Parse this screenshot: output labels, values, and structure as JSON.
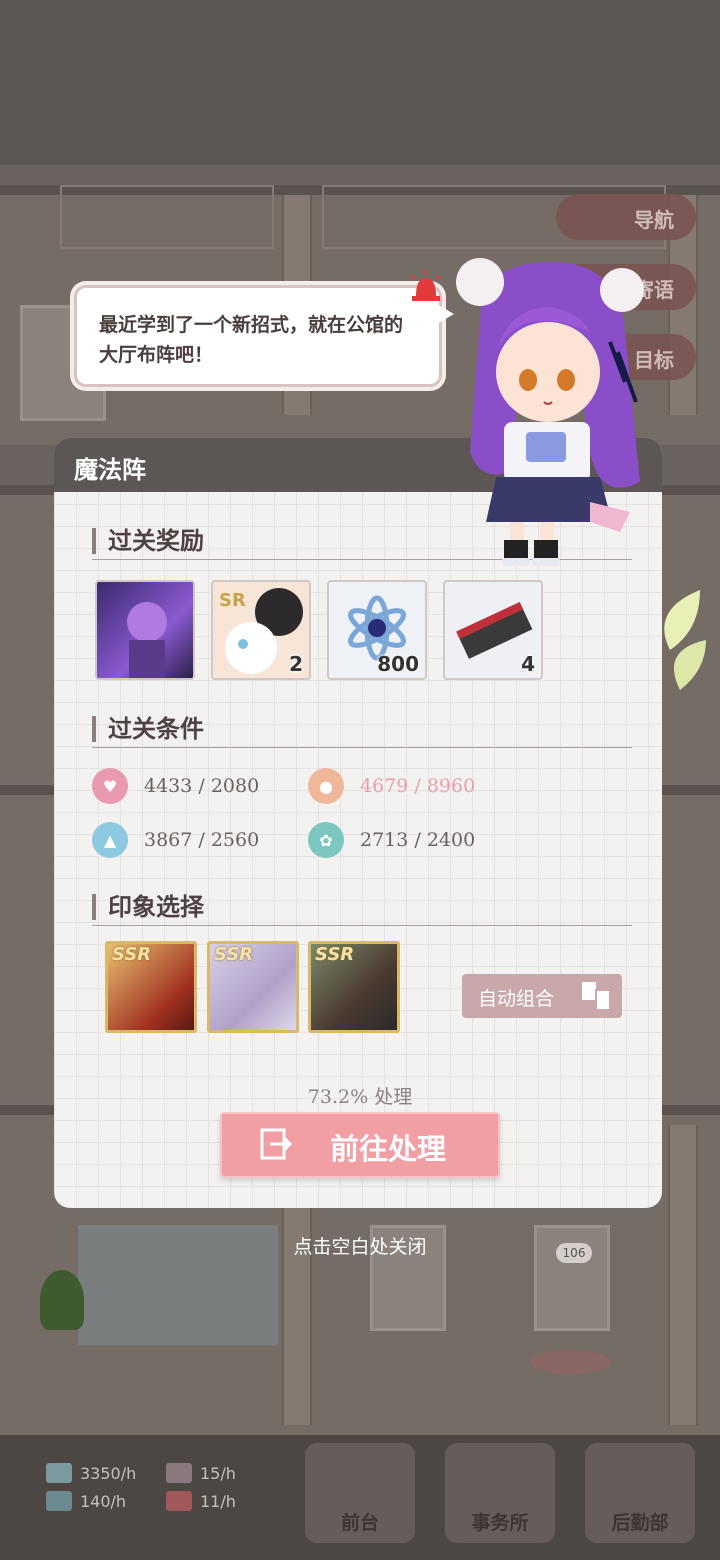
{
  "scene": {
    "side_buttons": [
      "导航",
      "寄语",
      "目标"
    ],
    "room_number": "106",
    "stats": [
      {
        "icon": "cash-icon",
        "value": "3350/h"
      },
      {
        "icon": "popularity-icon",
        "value": "15/h"
      },
      {
        "icon": "book-icon",
        "value": "140/h"
      },
      {
        "icon": "gift-icon",
        "value": "11/h"
      }
    ],
    "nav": [
      {
        "label": "前台",
        "icon": "front-desk-icon"
      },
      {
        "label": "事务所",
        "icon": "office-icon"
      },
      {
        "label": "后勤部",
        "icon": "logistics-icon"
      }
    ]
  },
  "speech": {
    "text": "最近学到了一个新招式，就在公馆的大厅布阵吧！"
  },
  "dialog": {
    "title": "魔法阵",
    "rewards_title": "过关奖励",
    "rewards": [
      {
        "name": "character-card-reward",
        "count": ""
      },
      {
        "name": "sr-cats-card-reward",
        "count": "2"
      },
      {
        "name": "crystal-flower-reward",
        "count": "800"
      },
      {
        "name": "ticket-reward",
        "count": "4"
      }
    ],
    "conditions_title": "过关条件",
    "conditions": [
      {
        "icon": "stamina-icon",
        "color": "#e99aae",
        "value": "4433",
        "target": "/ 2080",
        "met": true
      },
      {
        "icon": "person-icon",
        "color": "#f0b89a",
        "value": "4679",
        "target": "/ 8960",
        "met": false
      },
      {
        "icon": "graduation-icon",
        "color": "#8ec9e2",
        "value": "3867",
        "target": "/ 2560",
        "met": true
      },
      {
        "icon": "flower-icon",
        "color": "#7cc8c0",
        "value": "2713",
        "target": "/ 2400",
        "met": true
      }
    ],
    "impression_title": "印象选择",
    "impressions": [
      {
        "rarity": "SSR",
        "name": "blond-character-card"
      },
      {
        "rarity": "SSR",
        "name": "silver-hair-character-card"
      },
      {
        "rarity": "SSR",
        "name": "brown-hair-character-card"
      }
    ],
    "auto_button": "自动组合",
    "progress": "73.2% 处理",
    "go_button": "前往处理"
  },
  "close_hint": "点击空白处关闭",
  "colors": {
    "accent_pink": "#f19fa4",
    "unmet_condition": "#e8a0a6",
    "card_header": "#5c5654"
  }
}
